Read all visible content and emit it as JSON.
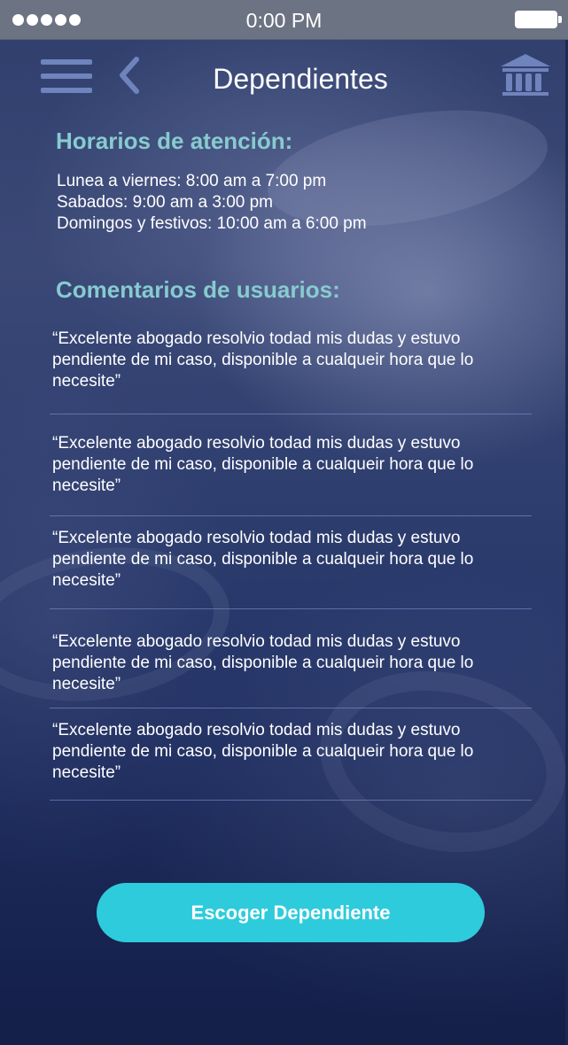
{
  "status_bar": {
    "time": "0:00 PM"
  },
  "header": {
    "title": "Dependientes"
  },
  "icons": {
    "menu": "hamburger-menu-icon",
    "back": "chevron-left-icon",
    "institution": "bank-building-icon"
  },
  "hours_section": {
    "title": "Horarios de atención:",
    "lines": [
      "Lunea a viernes: 8:00 am a 7:00 pm",
      "Sabados: 9:00 am a 3:00 pm",
      "Domingos y festivos: 10:00 am a 6:00 pm"
    ]
  },
  "comments_section": {
    "title": "Comentarios de usuarios:",
    "comments": [
      "“Excelente abogado resolvio todad mis dudas y estuvo pendiente de mi caso, disponible a cualqueir hora que lo necesite”",
      "“Excelente abogado resolvio todad mis dudas y estuvo pendiente de mi caso, disponible a cualqueir hora que lo necesite”",
      "“Excelente abogado resolvio todad mis dudas y estuvo pendiente de mi caso, disponible a cualqueir hora que lo necesite”",
      "“Excelente abogado resolvio todad mis dudas y estuvo pendiente de mi caso, disponible a cualqueir hora que lo necesite”",
      "“Excelente abogado resolvio todad mis dudas y estuvo pendiente de mi caso, disponible a cualqueir hora que lo necesite”"
    ]
  },
  "action": {
    "button_label": "Escoger Dependiente"
  },
  "colors": {
    "accent": "#2ecbdc",
    "section_title": "#87cbcf",
    "icon": "#6f83bd",
    "status_bar": "#6c7382"
  }
}
